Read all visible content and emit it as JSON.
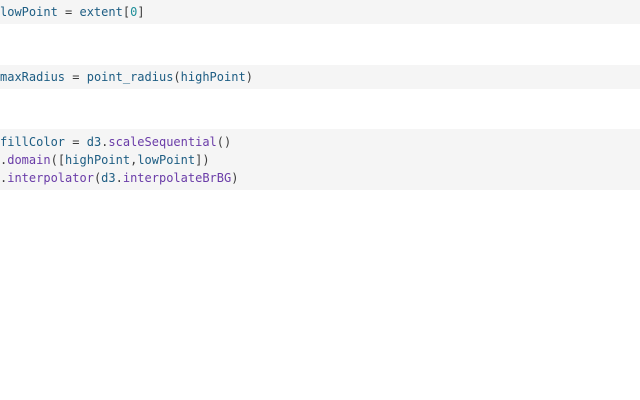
{
  "colors": {
    "cell_background": "#f5f5f5",
    "variable": "#1d5d83",
    "function": "#6a3ca8",
    "number": "#1f8f99",
    "punctuation": "#3b3b3b"
  },
  "cells": [
    {
      "lines": [
        {
          "tokens": [
            {
              "text": "lowPoint",
              "kind": "var"
            },
            {
              "text": " = ",
              "kind": "punc"
            },
            {
              "text": "extent",
              "kind": "var"
            },
            {
              "text": "[",
              "kind": "punc"
            },
            {
              "text": "0",
              "kind": "num"
            },
            {
              "text": "]",
              "kind": "punc"
            }
          ]
        }
      ]
    },
    {
      "lines": [
        {
          "tokens": [
            {
              "text": "maxRadius",
              "kind": "var"
            },
            {
              "text": " = ",
              "kind": "punc"
            },
            {
              "text": "point_radius",
              "kind": "var"
            },
            {
              "text": "(",
              "kind": "punc"
            },
            {
              "text": "highPoint",
              "kind": "var"
            },
            {
              "text": ")",
              "kind": "punc"
            }
          ]
        }
      ]
    },
    {
      "lines": [
        {
          "tokens": [
            {
              "text": "fillColor",
              "kind": "var"
            },
            {
              "text": " = ",
              "kind": "punc"
            },
            {
              "text": "d3",
              "kind": "var"
            },
            {
              "text": ".",
              "kind": "punc"
            },
            {
              "text": "scaleSequential",
              "kind": "fn"
            },
            {
              "text": "()",
              "kind": "punc"
            }
          ]
        },
        {
          "tokens": [
            {
              "text": ".",
              "kind": "punc"
            },
            {
              "text": "domain",
              "kind": "fn"
            },
            {
              "text": "([",
              "kind": "punc"
            },
            {
              "text": "highPoint",
              "kind": "var"
            },
            {
              "text": ",",
              "kind": "punc"
            },
            {
              "text": "lowPoint",
              "kind": "var"
            },
            {
              "text": "])",
              "kind": "punc"
            }
          ]
        },
        {
          "tokens": [
            {
              "text": ".",
              "kind": "punc"
            },
            {
              "text": "interpolator",
              "kind": "fn"
            },
            {
              "text": "(",
              "kind": "punc"
            },
            {
              "text": "d3",
              "kind": "var"
            },
            {
              "text": ".",
              "kind": "punc"
            },
            {
              "text": "interpolateBrBG",
              "kind": "fn"
            },
            {
              "text": ")",
              "kind": "punc"
            }
          ]
        }
      ]
    }
  ]
}
